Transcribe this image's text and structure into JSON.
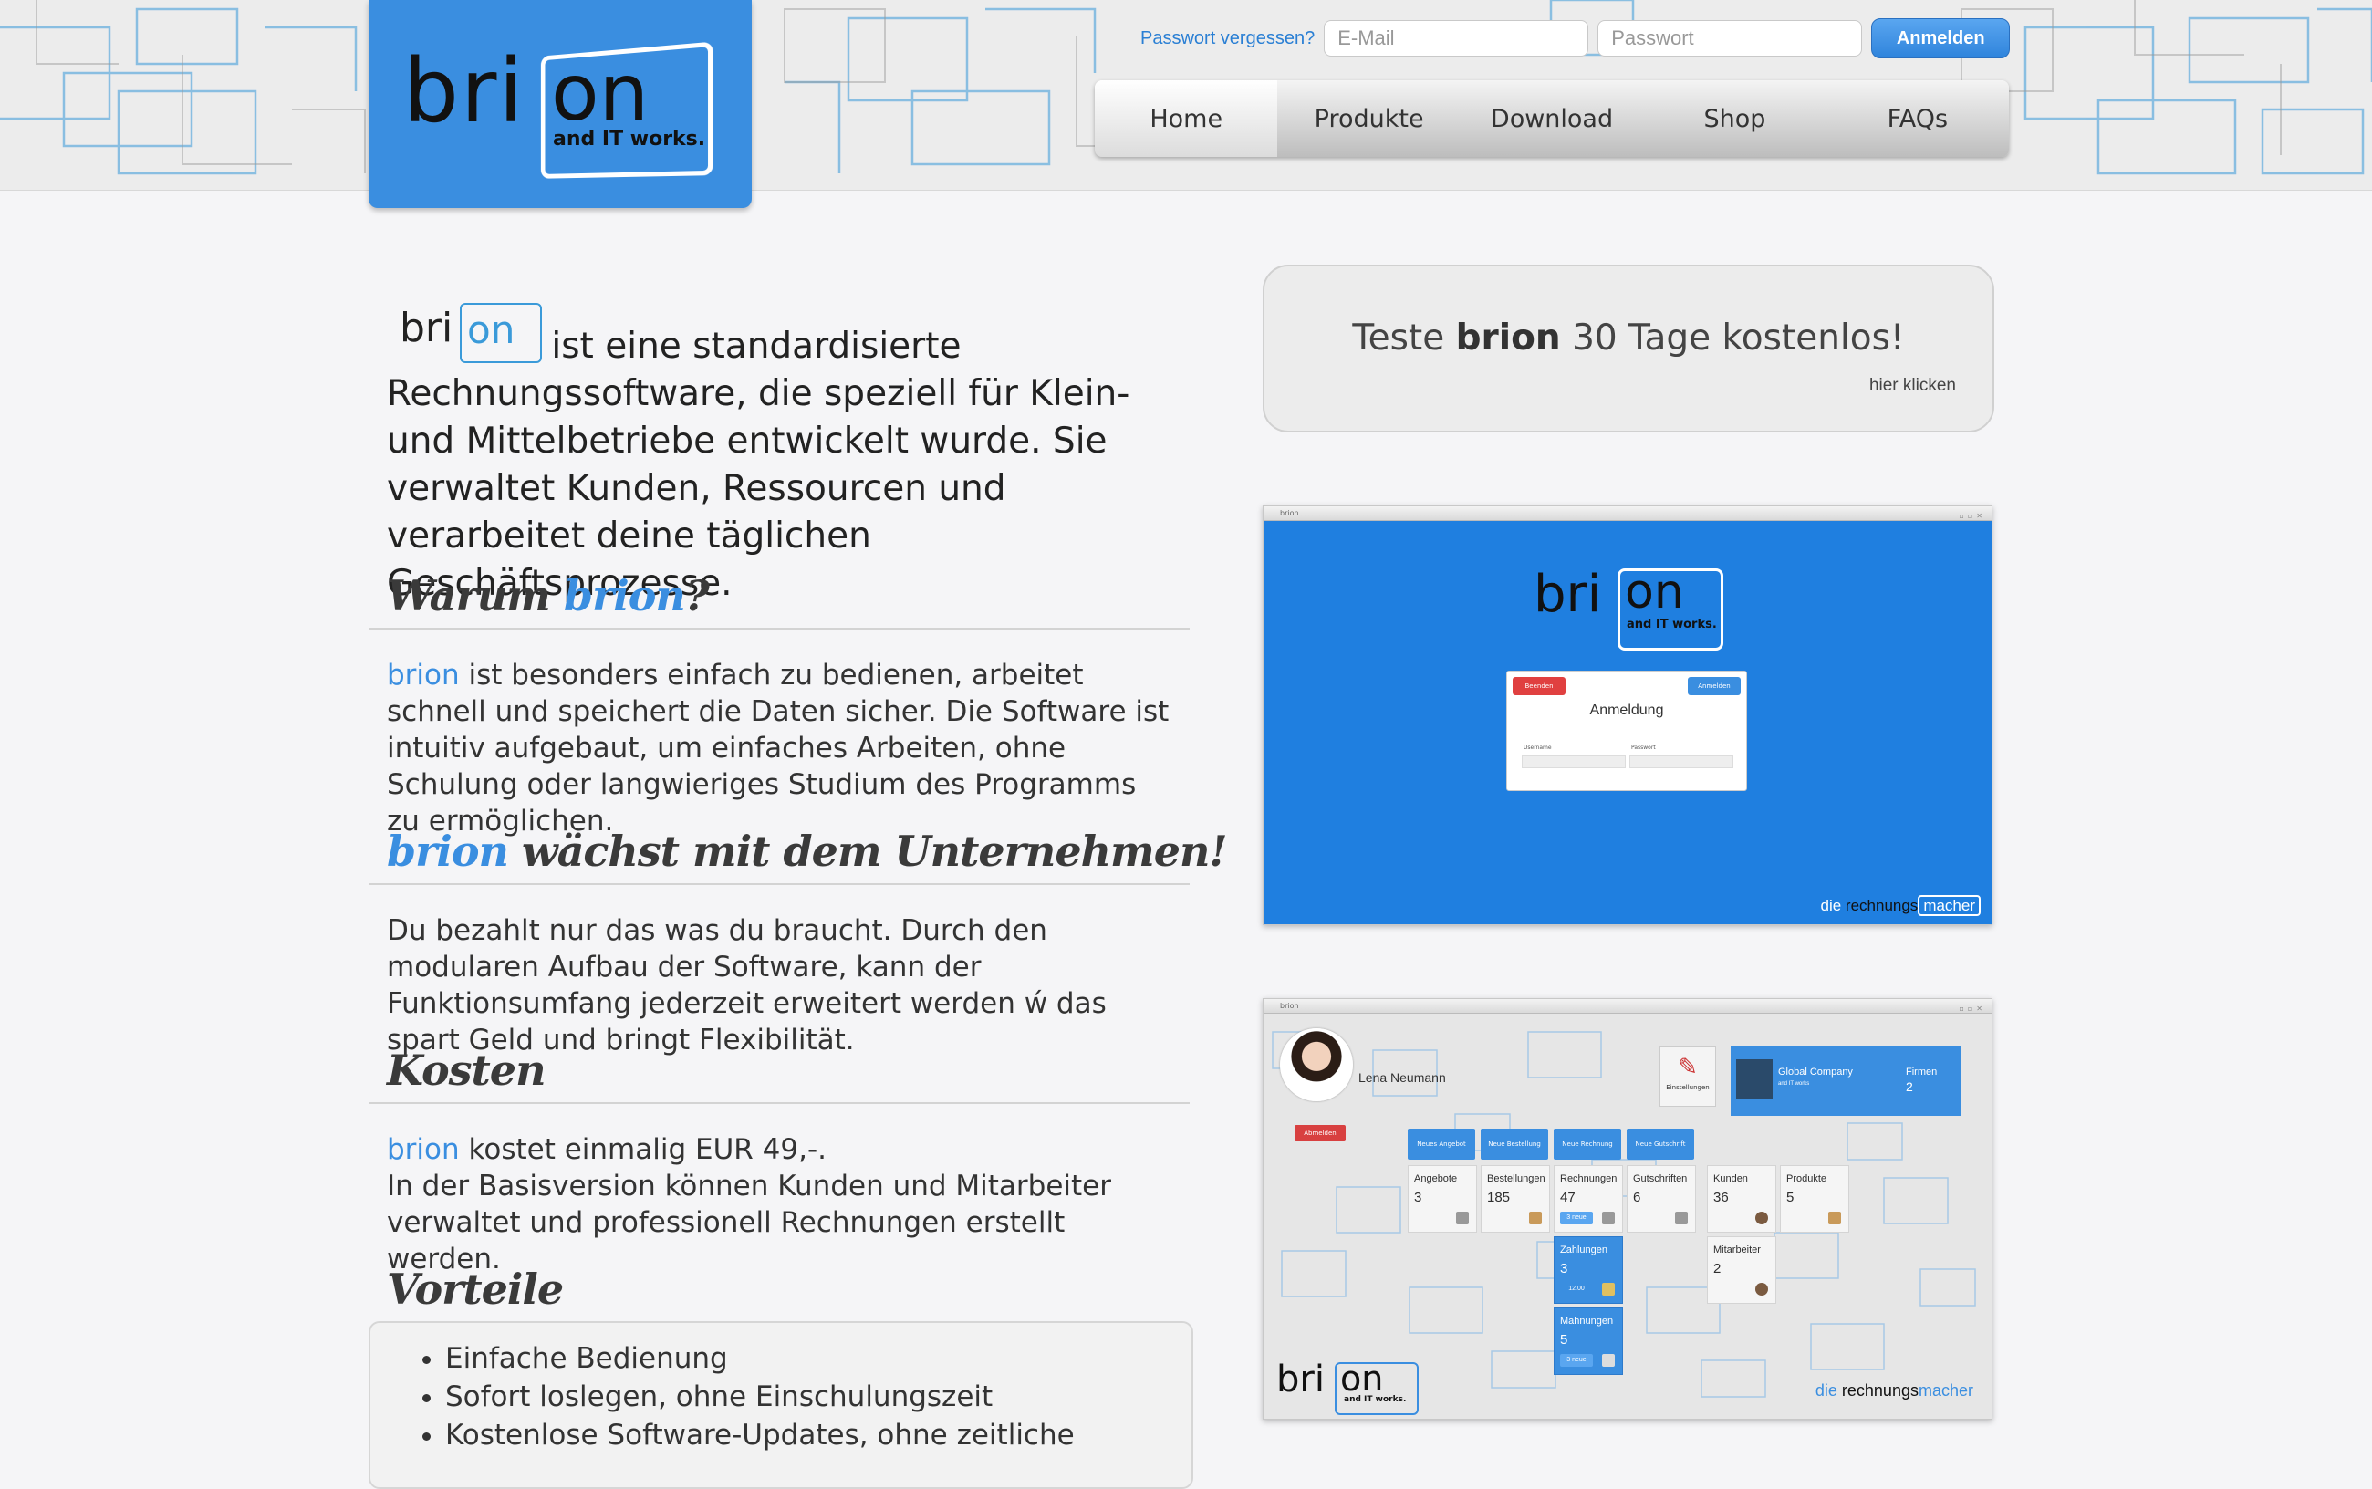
{
  "brand": {
    "logo_bri": "bri",
    "logo_on": "on",
    "tagline": "and IT works."
  },
  "login": {
    "forgot_label": "Passwort vergessen?",
    "email_placeholder": "E-Mail",
    "password_placeholder": "Passwort",
    "submit_label": "Anmelden"
  },
  "nav": {
    "items": [
      "Home",
      "Produkte",
      "Download",
      "Shop",
      "FAQs"
    ],
    "active": "Home"
  },
  "intro": {
    "text": "ist eine standardisierte Rechnungssoftware, die speziell für Klein- und Mittelbetriebe entwickelt wurde. Sie verwaltet Kunden, Ressourcen und verarbeitet deine täglichen Geschäftsprozesse."
  },
  "sections": {
    "warum": {
      "heading_prefix": "Warum ",
      "heading_highlight": "brion",
      "heading_suffix": "?",
      "text_highlight": "brion",
      "text": " ist besonders einfach zu bedienen, arbeitet schnell und speichert die Daten sicher. Die Software ist intuitiv aufgebaut, um einfaches Arbeiten, ohne Schulung oder langwieriges Studium des Programms zu ermöglichen."
    },
    "waechst": {
      "heading_highlight": "brion",
      "heading_suffix": " wächst mit dem Unternehmen!",
      "text": "Du bezahlt nur das was du braucht. Durch den modularen Aufbau der Software, kann der Funktionsumfang jederzeit erweitert werden ẃ das spart Geld und bringt Flexibilität."
    },
    "kosten": {
      "heading": "Kosten",
      "text_highlight": "brion",
      "text_line1": " kostet einmalig EUR 49,-.",
      "text_line2": "In der Basisversion können Kunden und Mitarbeiter verwaltet und professionell Rechnungen erstellt werden."
    },
    "vorteile": {
      "heading": "Vorteile",
      "items": [
        "Einfache Bedienung",
        "Sofort loslegen, ohne Einschulungszeit",
        "Kostenlose Software-Updates, ohne zeitliche"
      ]
    }
  },
  "trial": {
    "prefix": "Teste ",
    "brand": "brion",
    "suffix": " 30 Tage kostenlos!",
    "link": "hier klicken"
  },
  "screenshot1": {
    "window_title": "brion",
    "cancel": "Beenden",
    "login": "Anmelden",
    "title": "Anmeldung",
    "username_label": "Username",
    "password_label": "Passwort",
    "footer_die": "die ",
    "footer_rechnungs": "rechnungs",
    "footer_macher": "macher"
  },
  "screenshot2": {
    "window_title": "brion",
    "user_name": "Lena Neumann",
    "logout": "Abmelden",
    "settings": "Einstellungen",
    "company_name": "Global Company",
    "company_sub": "and IT works",
    "firmen_label": "Firmen",
    "firmen_value": "2",
    "buttons": [
      "Neues Angebot",
      "Neue Bestellung",
      "Neue Rechnung",
      "Neue Gutschrift"
    ],
    "tiles": [
      {
        "label": "Angebote",
        "value": "3"
      },
      {
        "label": "Bestellungen",
        "value": "185"
      },
      {
        "label": "Rechnungen",
        "value": "47",
        "tag": "3 neue"
      },
      {
        "label": "Gutschriften",
        "value": "6"
      },
      {
        "label": "Kunden",
        "value": "36"
      },
      {
        "label": "Produkte",
        "value": "5"
      },
      {
        "label": "Zahlungen",
        "value": "3",
        "tag": "12.00"
      },
      {
        "label": "Mitarbeiter",
        "value": "2"
      },
      {
        "label": "Mahnungen",
        "value": "5",
        "tag": "3 neue"
      }
    ],
    "footer_die": "die ",
    "footer_rechnungs": "rechnungs",
    "footer_macher": "macher"
  },
  "colors": {
    "accent": "#3a8ee0",
    "danger": "#d84040"
  }
}
